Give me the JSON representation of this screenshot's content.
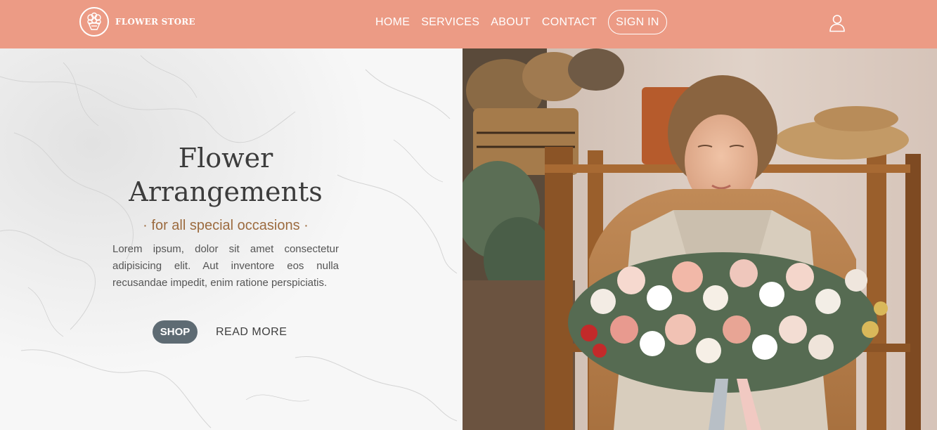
{
  "brand": {
    "name": "FLOWER STORE"
  },
  "nav": {
    "items": [
      "HOME",
      "SERVICES",
      "ABOUT",
      "CONTACT"
    ],
    "sign_in": "SIGN IN"
  },
  "hero": {
    "title_line1": "Flower",
    "title_line2": "Arrangements",
    "subtitle": "· for all special occasions ·",
    "body": "Lorem ipsum, dolor sit amet consectetur adipisicing elit. Aut inventore eos nulla recusandae impedit, enim ratione perspiciatis.",
    "shop_label": "SHOP",
    "read_more_label": "READ MORE"
  },
  "colors": {
    "navbar": "#ec9b85",
    "accent_text": "#9c6b3f",
    "shop_button": "#5e6b73",
    "title_text": "#3c3c3c"
  },
  "icons": {
    "logo": "flower-bouquet-icon",
    "account": "user-icon"
  }
}
